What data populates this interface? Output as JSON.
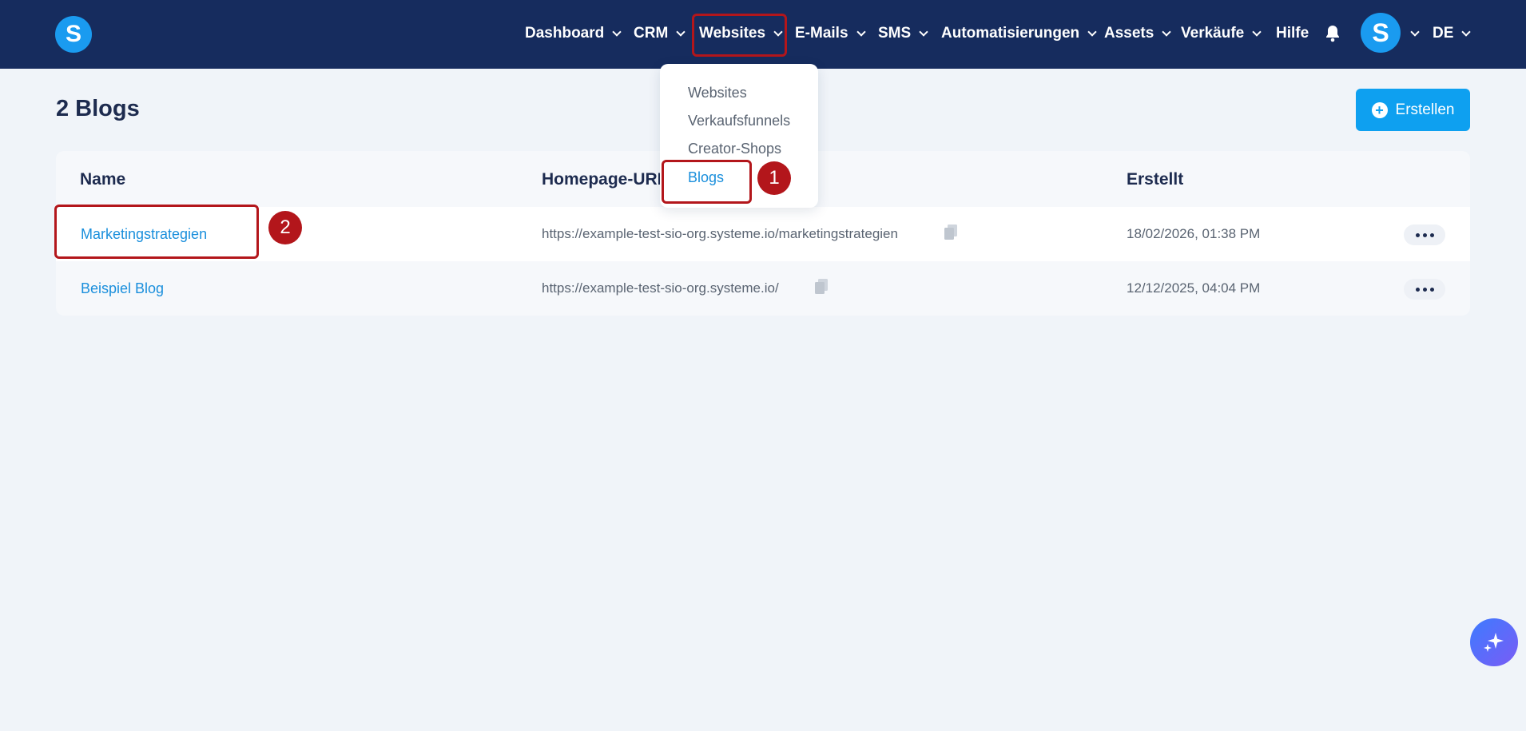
{
  "header": {
    "logo_letter": "S",
    "nav": [
      {
        "label": "Dashboard"
      },
      {
        "label": "CRM"
      },
      {
        "label": "Websites"
      },
      {
        "label": "E-Mails"
      },
      {
        "label": "SMS"
      },
      {
        "label": "Automatisierungen"
      },
      {
        "label": "Assets"
      },
      {
        "label": "Verkäufe"
      },
      {
        "label": "Hilfe"
      }
    ],
    "avatar_letter": "S",
    "language": "DE"
  },
  "dropdown": {
    "items": [
      {
        "label": "Websites"
      },
      {
        "label": "Verkaufsfunnels"
      },
      {
        "label": "Creator-Shops"
      },
      {
        "label": "Blogs"
      }
    ]
  },
  "page": {
    "title": "2 Blogs",
    "create_label": "Erstellen"
  },
  "table": {
    "headers": {
      "name": "Name",
      "url": "Homepage-URL",
      "created": "Erstellt"
    },
    "rows": [
      {
        "name": "Marketingstrategien",
        "url": "https://example-test-sio-org.systeme.io/marketingstrategien",
        "created": "18/02/2026, 01:38 PM"
      },
      {
        "name": "Beispiel Blog",
        "url": "https://example-test-sio-org.systeme.io/",
        "created": "12/12/2025, 04:04 PM"
      }
    ]
  },
  "annotations": {
    "marker1": "1",
    "marker2": "2"
  },
  "colors": {
    "header_bg": "#162c5e",
    "accent": "#0ea0f0",
    "link": "#1a8fdc",
    "highlight": "#b3161b"
  }
}
